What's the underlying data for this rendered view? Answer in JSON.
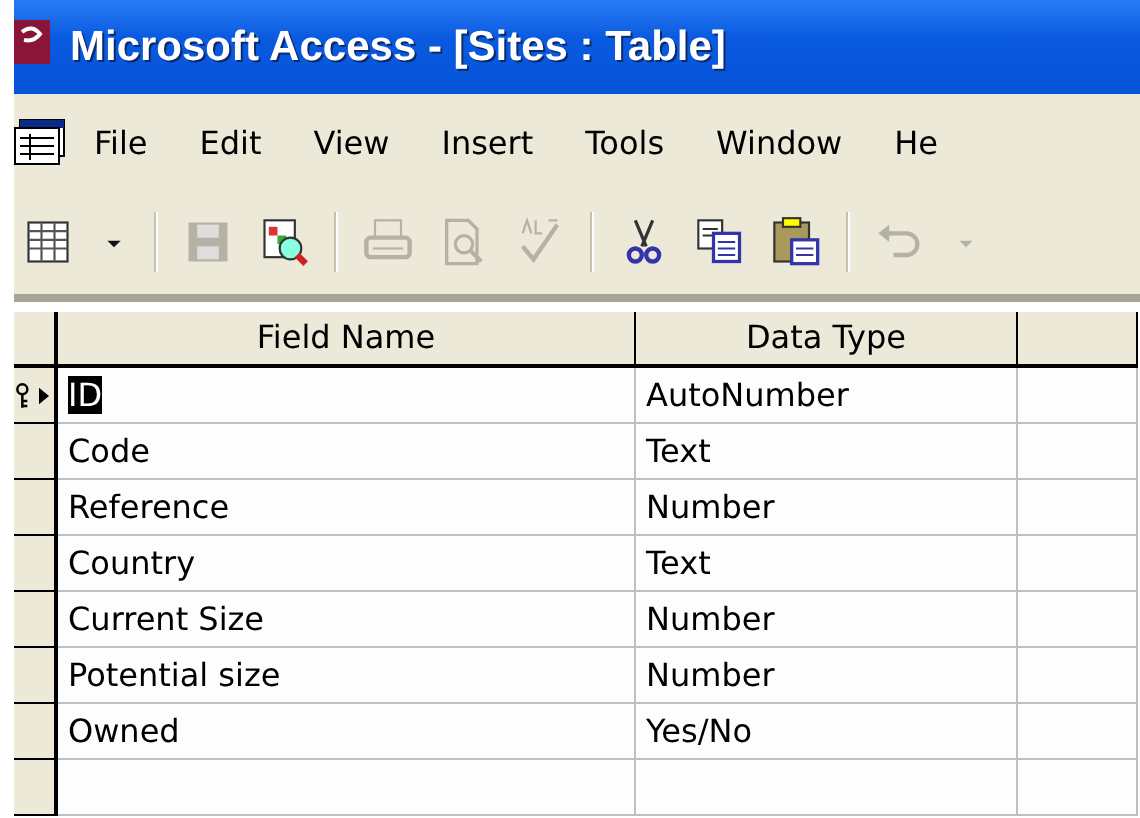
{
  "window": {
    "title": "Microsoft Access - [Sites : Table]"
  },
  "menu": [
    {
      "label": "File"
    },
    {
      "label": "Edit"
    },
    {
      "label": "View"
    },
    {
      "label": "Insert"
    },
    {
      "label": "Tools"
    },
    {
      "label": "Window"
    },
    {
      "label": "He"
    }
  ],
  "toolbar": [
    {
      "kind": "view",
      "disabled": false
    },
    {
      "kind": "dropdown",
      "disabled": false
    },
    {
      "kind": "separator"
    },
    {
      "kind": "save",
      "disabled": true
    },
    {
      "kind": "search",
      "disabled": false
    },
    {
      "kind": "separator"
    },
    {
      "kind": "print",
      "disabled": true
    },
    {
      "kind": "preview",
      "disabled": true
    },
    {
      "kind": "spelling",
      "disabled": true
    },
    {
      "kind": "separator"
    },
    {
      "kind": "cut",
      "disabled": false
    },
    {
      "kind": "copy",
      "disabled": false
    },
    {
      "kind": "paste",
      "disabled": false
    },
    {
      "kind": "separator"
    },
    {
      "kind": "undo",
      "disabled": true
    },
    {
      "kind": "dropdown",
      "disabled": true
    }
  ],
  "table": {
    "columns": [
      "Field Name",
      "Data Type"
    ],
    "rows": [
      {
        "field_name": "ID",
        "data_type": "AutoNumber",
        "selected": true,
        "primary_key": true
      },
      {
        "field_name": "Code",
        "data_type": "Text",
        "selected": false,
        "primary_key": false
      },
      {
        "field_name": "Reference",
        "data_type": "Number",
        "selected": false,
        "primary_key": false
      },
      {
        "field_name": "Country",
        "data_type": "Text",
        "selected": false,
        "primary_key": false
      },
      {
        "field_name": "Current Size",
        "data_type": "Number",
        "selected": false,
        "primary_key": false
      },
      {
        "field_name": "Potential size",
        "data_type": "Number",
        "selected": false,
        "primary_key": false
      },
      {
        "field_name": "Owned",
        "data_type": "Yes/No",
        "selected": false,
        "primary_key": false
      }
    ]
  }
}
